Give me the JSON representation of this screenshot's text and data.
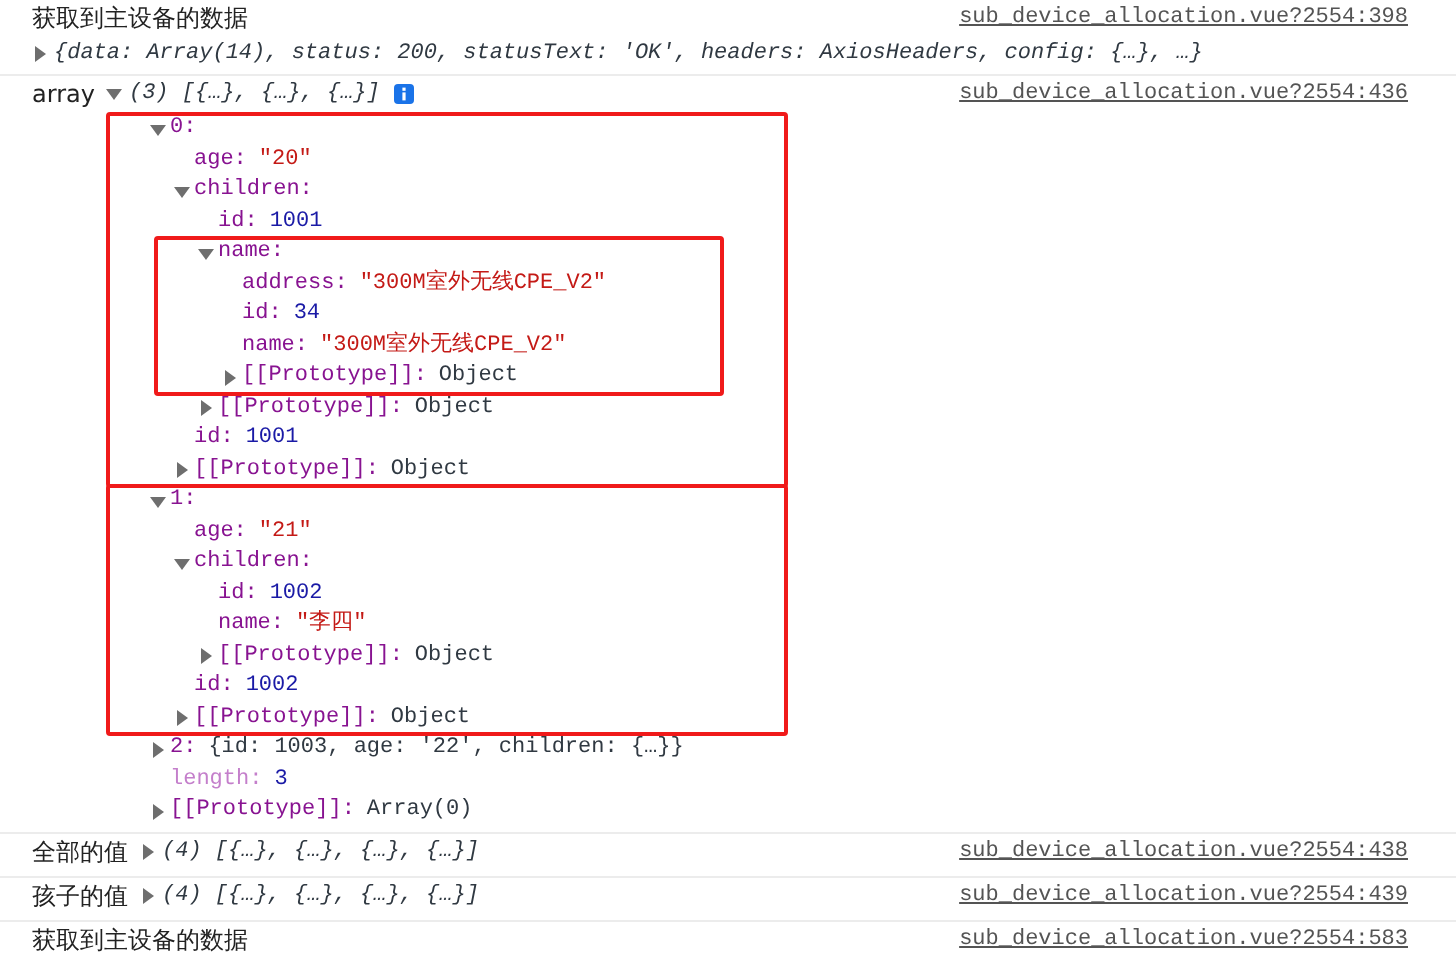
{
  "messages": [
    {
      "label": "获取到主设备的数据",
      "value": "{data: Array(14), status: 200, statusText: 'OK', headers: AxiosHeaders, config: {…}, …}",
      "expanded": false,
      "info": false,
      "source": "sub_device_allocation.vue?2554:398"
    },
    {
      "label": "array",
      "value": "(3) [{…}, {…}, {…}]",
      "expanded": true,
      "info": true,
      "source": "sub_device_allocation.vue?2554:436",
      "tree": [
        {
          "key": "0:",
          "kind": "branch",
          "expanded": true,
          "highlighted": true,
          "children": [
            {
              "key": "age:",
              "value": "\"20\"",
              "kind": "string",
              "dim": false
            },
            {
              "key": "children:",
              "kind": "branch",
              "expanded": true,
              "highlighted": false,
              "children": [
                {
                  "key": "id:",
                  "value": "1001",
                  "kind": "number",
                  "dim": false
                },
                {
                  "key": "name:",
                  "kind": "branch",
                  "expanded": true,
                  "highlighted": true,
                  "children": [
                    {
                      "key": "address:",
                      "value": "\"300M室外无线CPE_V2\"",
                      "kind": "string",
                      "dim": false
                    },
                    {
                      "key": "id:",
                      "value": "34",
                      "kind": "number",
                      "dim": false
                    },
                    {
                      "key": "name:",
                      "value": "\"300M室外无线CPE_V2\"",
                      "kind": "string",
                      "dim": false
                    },
                    {
                      "key": "[[Prototype]]:",
                      "value": "Object",
                      "kind": "branch",
                      "expanded": false,
                      "highlighted": false
                    }
                  ]
                },
                {
                  "key": "[[Prototype]]:",
                  "value": "Object",
                  "kind": "branch",
                  "expanded": false,
                  "highlighted": false
                }
              ]
            },
            {
              "key": "id:",
              "value": "1001",
              "kind": "number",
              "dim": false
            },
            {
              "key": "[[Prototype]]:",
              "value": "Object",
              "kind": "branch",
              "expanded": false,
              "highlighted": false
            }
          ]
        },
        {
          "key": "1:",
          "kind": "branch",
          "expanded": true,
          "highlighted": true,
          "children": [
            {
              "key": "age:",
              "value": "\"21\"",
              "kind": "string",
              "dim": false
            },
            {
              "key": "children:",
              "kind": "branch",
              "expanded": true,
              "highlighted": false,
              "children": [
                {
                  "key": "id:",
                  "value": "1002",
                  "kind": "number",
                  "dim": false
                },
                {
                  "key": "name:",
                  "value": "\"李四\"",
                  "kind": "string",
                  "dim": false
                },
                {
                  "key": "[[Prototype]]:",
                  "value": "Object",
                  "kind": "branch",
                  "expanded": false,
                  "highlighted": false
                }
              ]
            },
            {
              "key": "id:",
              "value": "1002",
              "kind": "number",
              "dim": false
            },
            {
              "key": "[[Prototype]]:",
              "value": "Object",
              "kind": "branch",
              "expanded": false,
              "highlighted": false
            }
          ]
        },
        {
          "key": "2:",
          "value": "{id: 1003, age: '22', children: {…}}",
          "kind": "branch",
          "expanded": false,
          "highlighted": false
        },
        {
          "key": "length:",
          "value": "3",
          "kind": "number",
          "dim": true
        },
        {
          "key": "[[Prototype]]:",
          "value": "Array(0)",
          "kind": "branch",
          "expanded": false,
          "highlighted": false
        }
      ]
    },
    {
      "label": "全部的值",
      "value": "(4) [{…}, {…}, {…}, {…}]",
      "expanded": false,
      "info": false,
      "source": "sub_device_allocation.vue?2554:438"
    },
    {
      "label": "孩子的值",
      "value": "(4) [{…}, {…}, {…}, {…}]",
      "expanded": false,
      "info": false,
      "source": "sub_device_allocation.vue?2554:439"
    },
    {
      "label": "获取到主设备的数据",
      "source": "sub_device_allocation.vue?2554:583"
    }
  ]
}
